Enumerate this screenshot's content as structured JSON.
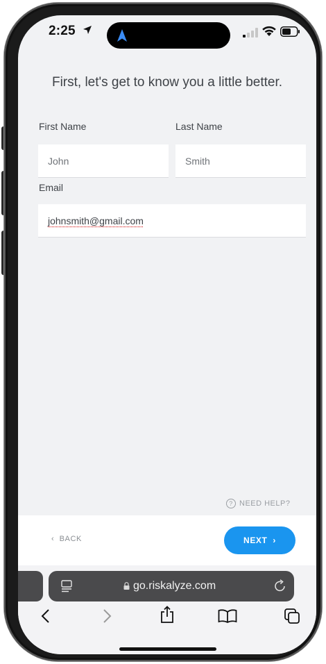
{
  "status_bar": {
    "time": "2:25"
  },
  "page": {
    "heading": "First, let's get to know you a little better.",
    "first_name": {
      "label": "First Name",
      "placeholder": "John"
    },
    "last_name": {
      "label": "Last Name",
      "placeholder": "Smith"
    },
    "email": {
      "label": "Email",
      "value": "johnsmith@gmail.com"
    },
    "help_label": "NEED HELP?"
  },
  "footer": {
    "back_label": "BACK",
    "next_label": "NEXT",
    "next_color": "#1a95ef"
  },
  "browser": {
    "url": "go.riskalyze.com",
    "toolbar_icons": [
      "back-icon",
      "forward-icon",
      "share-icon",
      "bookmarks-icon",
      "tabs-icon"
    ]
  }
}
